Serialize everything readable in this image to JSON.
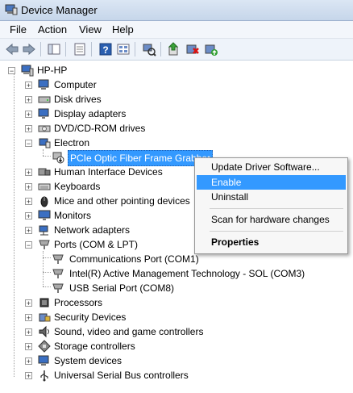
{
  "window": {
    "title": "Device Manager"
  },
  "menu": [
    "File",
    "Action",
    "View",
    "Help"
  ],
  "tree": {
    "root": "HP-HP",
    "items": [
      {
        "label": "Computer",
        "icon": "computer-icon",
        "expanded": false
      },
      {
        "label": "Disk drives",
        "icon": "disk-drive-icon",
        "expanded": false
      },
      {
        "label": "Display adapters",
        "icon": "display-adapter-icon",
        "expanded": false
      },
      {
        "label": "DVD/CD-ROM drives",
        "icon": "dvd-drive-icon",
        "expanded": false
      },
      {
        "label": "Electron",
        "icon": "electron-device-icon",
        "expanded": true,
        "children": [
          {
            "label": "PCIe Optic Fiber Frame Grabber",
            "icon": "disabled-device-icon",
            "selected": true
          }
        ]
      },
      {
        "label": "Human Interface Devices",
        "icon": "hid-icon",
        "expanded": false
      },
      {
        "label": "Keyboards",
        "icon": "keyboard-icon",
        "expanded": false
      },
      {
        "label": "Mice and other pointing devices",
        "icon": "mouse-icon",
        "expanded": false
      },
      {
        "label": "Monitors",
        "icon": "monitor-icon",
        "expanded": false
      },
      {
        "label": "Network adapters",
        "icon": "network-icon",
        "expanded": false
      },
      {
        "label": "Ports (COM & LPT)",
        "icon": "port-icon",
        "expanded": true,
        "children": [
          {
            "label": "Communications Port (COM1)",
            "icon": "port-icon"
          },
          {
            "label": "Intel(R) Active Management Technology - SOL (COM3)",
            "icon": "port-icon"
          },
          {
            "label": "USB Serial Port (COM8)",
            "icon": "port-icon"
          }
        ]
      },
      {
        "label": "Processors",
        "icon": "processor-icon",
        "expanded": false
      },
      {
        "label": "Security Devices",
        "icon": "security-icon",
        "expanded": false
      },
      {
        "label": "Sound, video and game controllers",
        "icon": "sound-icon",
        "expanded": false
      },
      {
        "label": "Storage controllers",
        "icon": "storage-icon",
        "expanded": false
      },
      {
        "label": "System devices",
        "icon": "system-icon",
        "expanded": false
      },
      {
        "label": "Universal Serial Bus controllers",
        "icon": "usb-icon",
        "expanded": false
      }
    ]
  },
  "context_menu": {
    "items": [
      "Update Driver Software...",
      "Enable",
      "Uninstall",
      "Scan for hardware changes",
      "Properties"
    ],
    "highlighted": "Enable"
  },
  "colors": {
    "selection": "#3399ff",
    "titlebar": "#c6d6ea"
  }
}
